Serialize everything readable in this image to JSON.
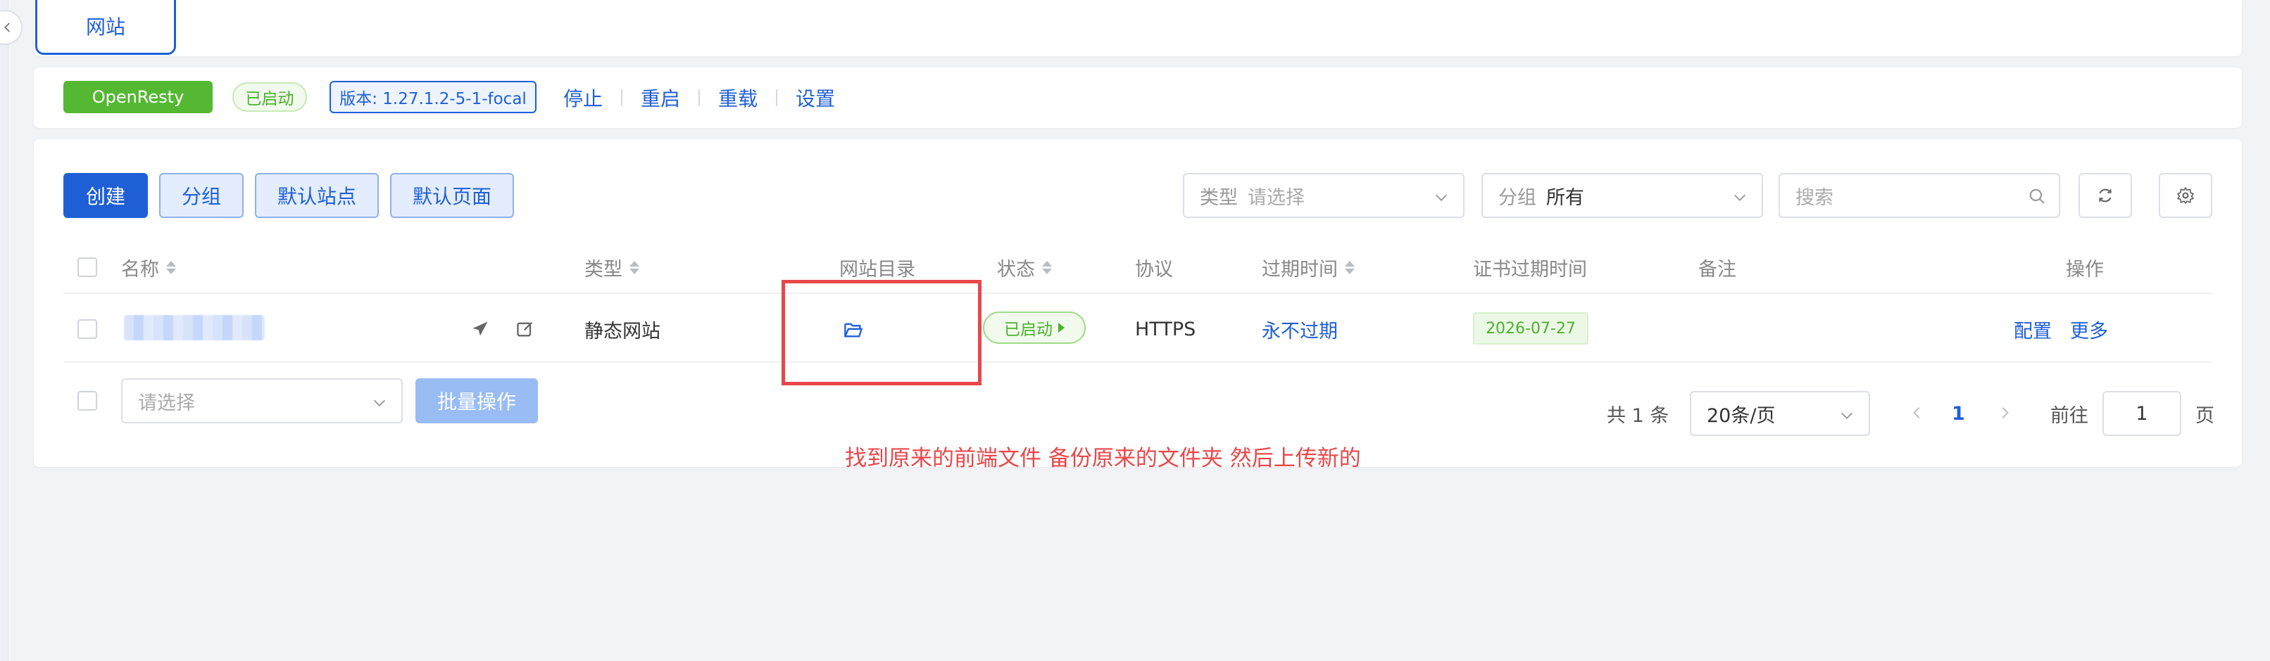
{
  "tabs": {
    "active": "网站"
  },
  "status_bar": {
    "app_name": "OpenResty",
    "status": "已启动",
    "version": "版本: 1.27.1.2-5-1-focal",
    "actions": [
      "停止",
      "重启",
      "重载",
      "设置"
    ]
  },
  "toolbar": {
    "create": "创建",
    "group": "分组",
    "default_site": "默认站点",
    "default_page": "默认页面",
    "type_filter": {
      "label": "类型",
      "placeholder": "请选择"
    },
    "group_filter": {
      "label": "分组",
      "value": "所有"
    },
    "search_placeholder": "搜索"
  },
  "table": {
    "headers": {
      "name": "名称",
      "type": "类型",
      "dir": "网站目录",
      "status": "状态",
      "protocol": "协议",
      "expire": "过期时间",
      "cert_expire": "证书过期时间",
      "remark": "备注",
      "ops": "操作"
    },
    "rows": [
      {
        "type": "静态网站",
        "status": "已启动",
        "protocol": "HTTPS",
        "expire": "永不过期",
        "cert_expire": "2026-07-27",
        "op_config": "配置",
        "op_more": "更多"
      }
    ]
  },
  "batch": {
    "placeholder": "请选择",
    "button": "批量操作"
  },
  "pagination": {
    "total": "共 1 条",
    "page_size": "20条/页",
    "current": "1",
    "goto_label": "前往",
    "goto_value": "1",
    "page_unit": "页"
  },
  "annotation": "找到原来的前端文件 备份原来的文件夹 然后上传新的",
  "colors": {
    "primary": "#1f5fd6",
    "success": "#54b832",
    "annotation": "#e8474a"
  }
}
